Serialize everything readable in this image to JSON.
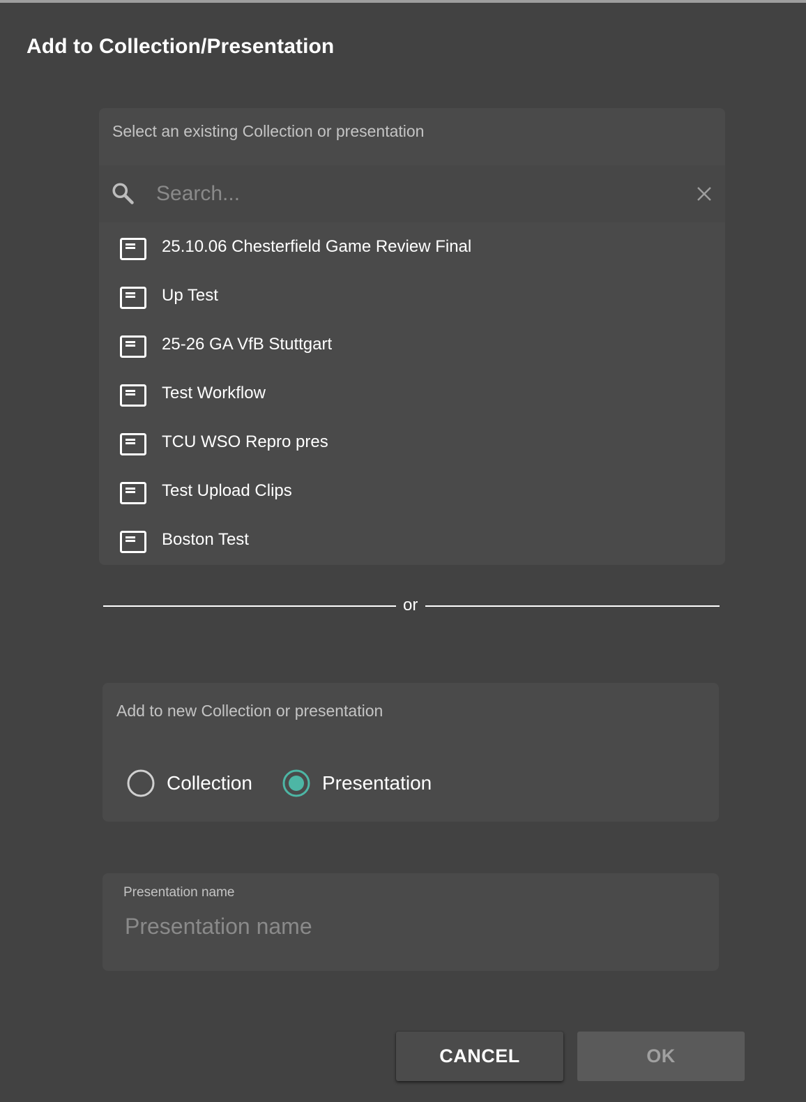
{
  "dialog": {
    "title": "Add to Collection/Presentation"
  },
  "existing": {
    "label": "Select an existing Collection or presentation",
    "search_placeholder": "Search...",
    "items": [
      {
        "label": "25.10.06 Chesterfield Game Review Final"
      },
      {
        "label": "Up Test"
      },
      {
        "label": "25-26 GA VfB Stuttgart"
      },
      {
        "label": "Test Workflow"
      },
      {
        "label": "TCU WSO Repro pres"
      },
      {
        "label": "Test Upload Clips"
      },
      {
        "label": "Boston Test"
      }
    ]
  },
  "divider": {
    "text": "or"
  },
  "new_item": {
    "label": "Add to new Collection or presentation",
    "options": [
      {
        "label": "Collection",
        "selected": false
      },
      {
        "label": "Presentation",
        "selected": true
      }
    ]
  },
  "name_field": {
    "label": "Presentation name",
    "placeholder": "Presentation name",
    "value": ""
  },
  "buttons": {
    "cancel": "CANCEL",
    "ok": "OK"
  },
  "colors": {
    "background": "#424242",
    "panel": "#4a4a4a",
    "accent": "#4db6a5",
    "muted_text": "#c4c4c4"
  },
  "icons": {
    "search": "search-icon",
    "clear": "close-icon",
    "list_item": "presentation-icon"
  }
}
